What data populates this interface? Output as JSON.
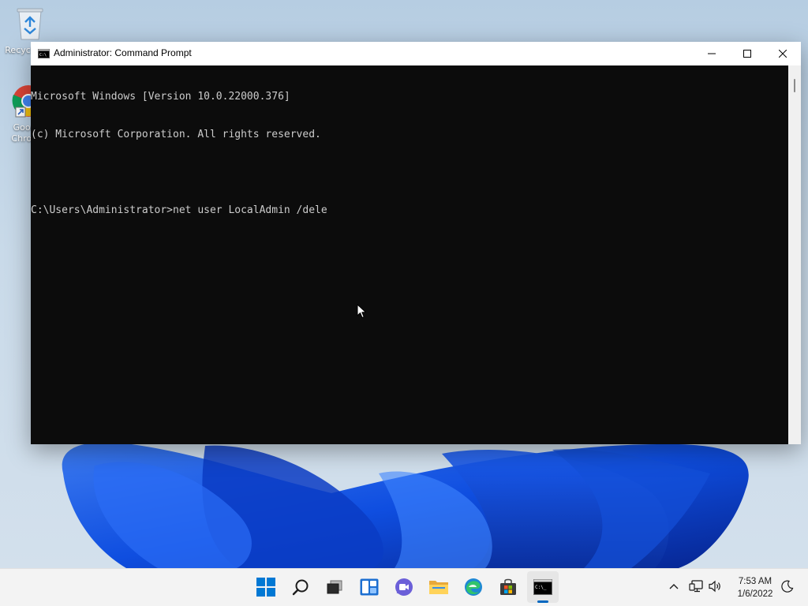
{
  "desktop": {
    "icons": [
      {
        "label": "Recycle Bin",
        "icon": "recycle-bin-icon"
      },
      {
        "label": "Google Chrome",
        "icon": "chrome-icon"
      }
    ]
  },
  "window": {
    "title": "Administrator: Command Prompt",
    "title_icon": "cmd-icon",
    "buttons": {
      "minimize": "minimize-icon",
      "maximize": "maximize-icon",
      "close": "close-icon"
    }
  },
  "console": {
    "lines": [
      "Microsoft Windows [Version 10.0.22000.376]",
      "(c) Microsoft Corporation. All rights reserved.",
      "",
      "C:\\Users\\Administrator>net user LocalAdmin /dele"
    ],
    "background": "#0c0c0c",
    "foreground": "#cccccc"
  },
  "taskbar": {
    "apps": [
      {
        "name": "Start",
        "icon": "windows-start-icon"
      },
      {
        "name": "Search",
        "icon": "search-icon"
      },
      {
        "name": "Task View",
        "icon": "task-view-icon"
      },
      {
        "name": "Widgets",
        "icon": "widgets-icon"
      },
      {
        "name": "Chat",
        "icon": "chat-icon"
      },
      {
        "name": "File Explorer",
        "icon": "folder-icon"
      },
      {
        "name": "Microsoft Edge",
        "icon": "edge-icon"
      },
      {
        "name": "Microsoft Store",
        "icon": "store-icon"
      },
      {
        "name": "Command Prompt",
        "icon": "cmd-icon",
        "active": true
      }
    ],
    "tray": {
      "icons": [
        "chevron-up-icon",
        "network-icon",
        "volume-icon"
      ],
      "time": "7:53 AM",
      "date": "1/6/2022",
      "notification_icon": "focus-assist-icon"
    },
    "accent": "#0067c0"
  }
}
